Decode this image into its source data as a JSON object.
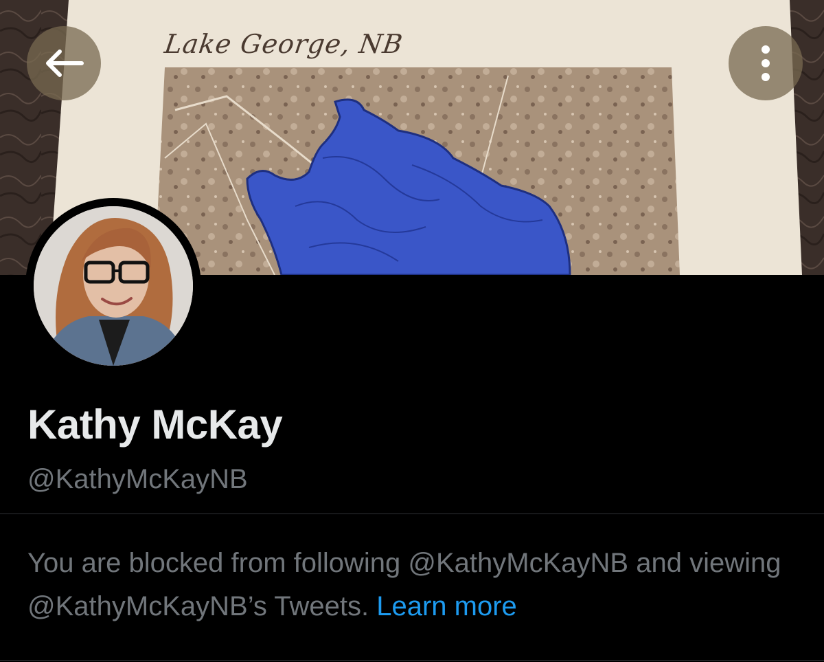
{
  "banner": {
    "title": "Lake George, NB",
    "back_icon": "arrow-left-icon",
    "more_icon": "more-vertical-icon"
  },
  "profile": {
    "display_name": "Kathy McKay",
    "handle": "@KathyMcKayNB"
  },
  "notice": {
    "text": "You are blocked from following @KathyMcKayNB and viewing @KathyMcKayNB’s Tweets.",
    "link_label": "Learn more"
  },
  "colors": {
    "background": "#000000",
    "text_primary": "#e7e9ea",
    "text_secondary": "#71767b",
    "link": "#1d9bf0",
    "lake_blue": "#3a56c8"
  }
}
